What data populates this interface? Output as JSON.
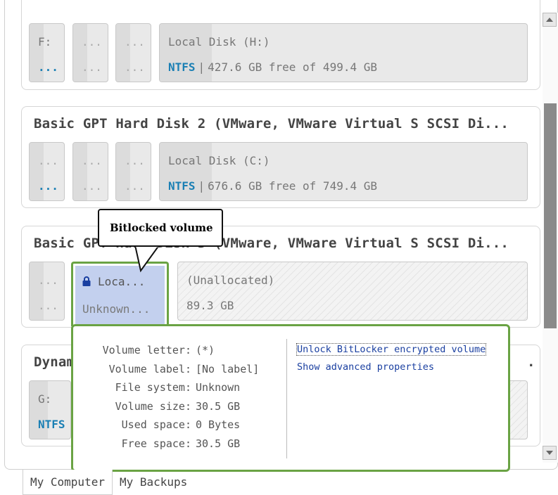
{
  "disks": [
    {
      "title": "",
      "partitions": [
        {
          "line1": "F:",
          "line2": "..."
        },
        {
          "line1": "...",
          "line2": "..."
        },
        {
          "line1": "...",
          "line2": "..."
        },
        {
          "line1": "Local Disk (H:)",
          "fs": "NTFS",
          "sep": "|",
          "free": "427.6 GB free of 499.4 GB"
        }
      ]
    },
    {
      "title": "Basic GPT Hard Disk 2 (VMware, VMware Virtual S SCSI Di...",
      "partitions": [
        {
          "line1": "...",
          "line2": "..."
        },
        {
          "line1": "...",
          "line2": "..."
        },
        {
          "line1": "...",
          "line2": "..."
        },
        {
          "line1": "Local Disk (C:)",
          "fs": "NTFS",
          "sep": "|",
          "free": "676.6 GB free of 749.4 GB"
        }
      ]
    },
    {
      "title": "Basic GPT Hard Disk 3 (VMware, VMware Virtual S SCSI Di...",
      "partitions": [
        {
          "line1": "...",
          "line2": "..."
        },
        {
          "line1": "Loca...",
          "line2": "Unknown..."
        },
        {
          "line1": "(Unallocated)",
          "line2": "89.3 GB"
        }
      ]
    },
    {
      "title": "Dynam",
      "title_end": ".",
      "partitions": [
        {
          "line1": "G:",
          "line2": "NTFS"
        }
      ]
    }
  ],
  "callout": {
    "text": "Bitlocked volume"
  },
  "popup": {
    "properties": [
      {
        "label": "Volume letter:",
        "value": "(*)"
      },
      {
        "label": "Volume label:",
        "value": "[No label]"
      },
      {
        "label": "File system:",
        "value": "Unknown"
      },
      {
        "label": "Volume size:",
        "value": "30.5 GB"
      },
      {
        "label": "Used space:",
        "value": "0 Bytes"
      },
      {
        "label": "Free space:",
        "value": "30.5 GB"
      }
    ],
    "actions": [
      {
        "label": "Unlock BitLocker encrypted volume"
      },
      {
        "label": "Show advanced properties"
      }
    ]
  },
  "tabs": [
    {
      "label": "My Computer",
      "active": true
    },
    {
      "label": "My Backups",
      "active": false
    }
  ],
  "colors": {
    "accent_green": "#6aa344",
    "fs_blue": "#1a7fb4",
    "selected_partition": "#c3d0ee",
    "link_blue": "#1a3fa0"
  },
  "icons": {
    "lock": "lock-icon"
  }
}
